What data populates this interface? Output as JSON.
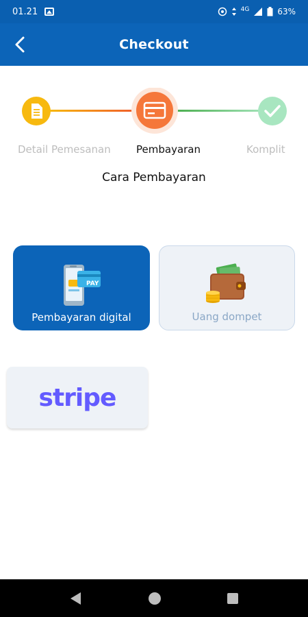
{
  "status_bar": {
    "time": "01.21",
    "network": "4G",
    "battery": "63%"
  },
  "app_bar": {
    "title": "Checkout",
    "back_icon": "chevron-left-icon"
  },
  "stepper": {
    "steps": [
      {
        "label": "Detail Pemesanan",
        "icon": "document-icon",
        "state": "done",
        "color": "#f7b90f"
      },
      {
        "label": "Pembayaran",
        "icon": "card-icon",
        "state": "active",
        "color": "#f5773a"
      },
      {
        "label": "Komplit",
        "icon": "check-icon",
        "state": "pending",
        "color": "#a8e6c0"
      }
    ]
  },
  "section": {
    "title": "Cara Pembayaran"
  },
  "payment_methods": [
    {
      "label": "Pembayaran digital",
      "icon": "phone-pay-icon",
      "selected": true
    },
    {
      "label": "Uang dompet",
      "icon": "wallet-icon",
      "selected": false
    }
  ],
  "gateways": [
    {
      "label": "stripe",
      "icon": "stripe-logo"
    }
  ],
  "colors": {
    "primary": "#0c64b8",
    "stripe": "#635bff",
    "card_bg": "#eef2f7"
  }
}
